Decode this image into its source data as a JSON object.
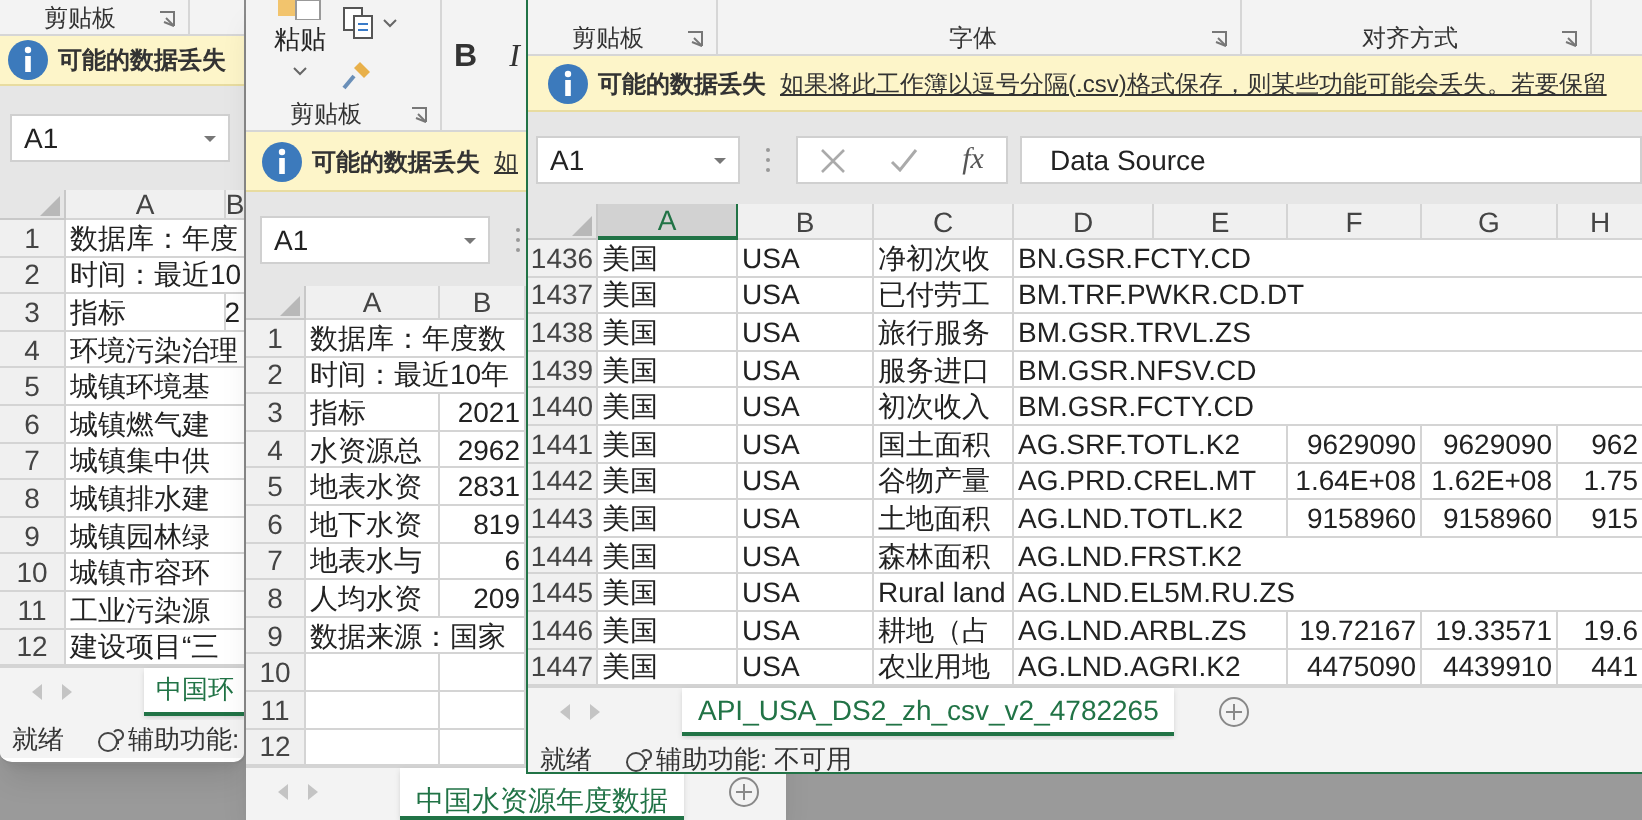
{
  "windows": [
    {
      "ribbon": {
        "groups": [
          {
            "label": "剪贴板"
          }
        ]
      },
      "info_bar": {
        "title": "可能的数据丢失"
      },
      "name_box": "A1",
      "columns": [
        {
          "label": "A",
          "selected": false
        },
        {
          "label": "B",
          "selected": false
        }
      ],
      "rows": [
        {
          "header": "1",
          "cells": {
            "A": "数据库：年度"
          }
        },
        {
          "header": "2",
          "cells": {
            "A": "时间：最近10"
          }
        },
        {
          "header": "3",
          "cells": {
            "A": "指标",
            "B": "2"
          }
        },
        {
          "header": "4",
          "cells": {
            "A": "环境污染治理"
          }
        },
        {
          "header": "5",
          "cells": {
            "A": "城镇环境基"
          }
        },
        {
          "header": "6",
          "cells": {
            "A": "城镇燃气建"
          }
        },
        {
          "header": "7",
          "cells": {
            "A": "城镇集中供"
          }
        },
        {
          "header": "8",
          "cells": {
            "A": "城镇排水建"
          }
        },
        {
          "header": "9",
          "cells": {
            "A": "城镇园林绿"
          }
        },
        {
          "header": "10",
          "cells": {
            "A": "城镇市容环"
          }
        },
        {
          "header": "11",
          "cells": {
            "A": "工业污染源"
          }
        },
        {
          "header": "12",
          "cells": {
            "A": "建设项目“三"
          }
        }
      ],
      "sheet_tabs": [
        {
          "label": "中国环",
          "selected": true
        }
      ],
      "status_bar": {
        "ready": "就绪",
        "accessibility": "辅助功能:"
      }
    },
    {
      "ribbon": {
        "paste_button": "粘贴",
        "font_buttons": [
          "B",
          "I"
        ],
        "groups": [
          {
            "label": "剪贴板"
          }
        ]
      },
      "info_bar": {
        "title": "可能的数据丢失",
        "message": "如"
      },
      "name_box": "A1",
      "columns": [
        {
          "label": "A",
          "selected": false
        },
        {
          "label": "B",
          "selected": false
        }
      ],
      "rows": [
        {
          "header": "1",
          "cells": {
            "A": "数据库：年度数"
          }
        },
        {
          "header": "2",
          "cells": {
            "A": "时间：最近10年"
          }
        },
        {
          "header": "3",
          "cells": {
            "A": "指标",
            "B": "2021"
          }
        },
        {
          "header": "4",
          "cells": {
            "A": "水资源总",
            "B": "2962"
          }
        },
        {
          "header": "5",
          "cells": {
            "A": "地表水资",
            "B": "2831"
          }
        },
        {
          "header": "6",
          "cells": {
            "A": "地下水资",
            "B": "819"
          }
        },
        {
          "header": "7",
          "cells": {
            "A": "地表水与",
            "B": "6"
          }
        },
        {
          "header": "8",
          "cells": {
            "A": "人均水资",
            "B": "209"
          }
        },
        {
          "header": "9",
          "cells": {
            "A": "数据来源：国家"
          }
        },
        {
          "header": "10",
          "cells": {}
        },
        {
          "header": "11",
          "cells": {}
        },
        {
          "header": "12",
          "cells": {}
        }
      ],
      "sheet_tabs": [
        {
          "label": "中国水资源年度数据",
          "selected": true
        }
      ]
    },
    {
      "ribbon": {
        "groups": [
          {
            "label": "剪贴板"
          },
          {
            "label": "字体"
          },
          {
            "label": "对齐方式"
          }
        ]
      },
      "info_bar": {
        "title": "可能的数据丢失",
        "message": "如果将此工作簿以逗号分隔(.csv)格式保存，则某些功能可能会丢失。若要保留"
      },
      "name_box": "A1",
      "formula_bar": {
        "function_label": "fx",
        "value": "Data Source"
      },
      "columns": [
        {
          "label": "A",
          "selected": true
        },
        {
          "label": "B",
          "selected": false
        },
        {
          "label": "C",
          "selected": false
        },
        {
          "label": "D",
          "selected": false
        },
        {
          "label": "E",
          "selected": false
        },
        {
          "label": "F",
          "selected": false
        },
        {
          "label": "G",
          "selected": false
        },
        {
          "label": "H",
          "selected": false
        }
      ],
      "rows": [
        {
          "header": "1436",
          "cells": {
            "A": "美国",
            "B": "USA",
            "C": "净初次收",
            "D": "BN.GSR.FCTY.CD"
          }
        },
        {
          "header": "1437",
          "cells": {
            "A": "美国",
            "B": "USA",
            "C": "已付劳工",
            "D": "BM.TRF.PWKR.CD.DT"
          }
        },
        {
          "header": "1438",
          "cells": {
            "A": "美国",
            "B": "USA",
            "C": "旅行服务",
            "D": "BM.GSR.TRVL.ZS"
          }
        },
        {
          "header": "1439",
          "cells": {
            "A": "美国",
            "B": "USA",
            "C": "服务进口",
            "D": "BM.GSR.NFSV.CD"
          }
        },
        {
          "header": "1440",
          "cells": {
            "A": "美国",
            "B": "USA",
            "C": "初次收入",
            "D": "BM.GSR.FCTY.CD"
          }
        },
        {
          "header": "1441",
          "cells": {
            "A": "美国",
            "B": "USA",
            "C": "国土面积",
            "D": "AG.SRF.TOTL.K2",
            "F": "9629090",
            "G": "9629090",
            "H": "962"
          }
        },
        {
          "header": "1442",
          "cells": {
            "A": "美国",
            "B": "USA",
            "C": "谷物产量",
            "D": "AG.PRD.CREL.MT",
            "F": "1.64E+08",
            "G": "1.62E+08",
            "H": "1.75"
          }
        },
        {
          "header": "1443",
          "cells": {
            "A": "美国",
            "B": "USA",
            "C": "土地面积",
            "D": "AG.LND.TOTL.K2",
            "F": "9158960",
            "G": "9158960",
            "H": "915"
          }
        },
        {
          "header": "1444",
          "cells": {
            "A": "美国",
            "B": "USA",
            "C": "森林面积",
            "D": "AG.LND.FRST.K2"
          }
        },
        {
          "header": "1445",
          "cells": {
            "A": "美国",
            "B": "USA",
            "C": "Rural land",
            "D": "AG.LND.EL5M.RU.ZS"
          }
        },
        {
          "header": "1446",
          "cells": {
            "A": "美国",
            "B": "USA",
            "C": "耕地（占",
            "D": "AG.LND.ARBL.ZS",
            "F": "19.72167",
            "G": "19.33571",
            "H": "19.6"
          }
        },
        {
          "header": "1447",
          "cells": {
            "A": "美国",
            "B": "USA",
            "C": "农业用地",
            "D": "AG.LND.AGRI.K2",
            "F": "4475090",
            "G": "4439910",
            "H": "441"
          }
        }
      ],
      "sheet_tabs": [
        {
          "label": "API_USA_DS2_zh_csv_v2_4782265",
          "selected": true
        }
      ],
      "status_bar": {
        "ready": "就绪",
        "accessibility": "辅助功能: 不可用"
      }
    }
  ]
}
